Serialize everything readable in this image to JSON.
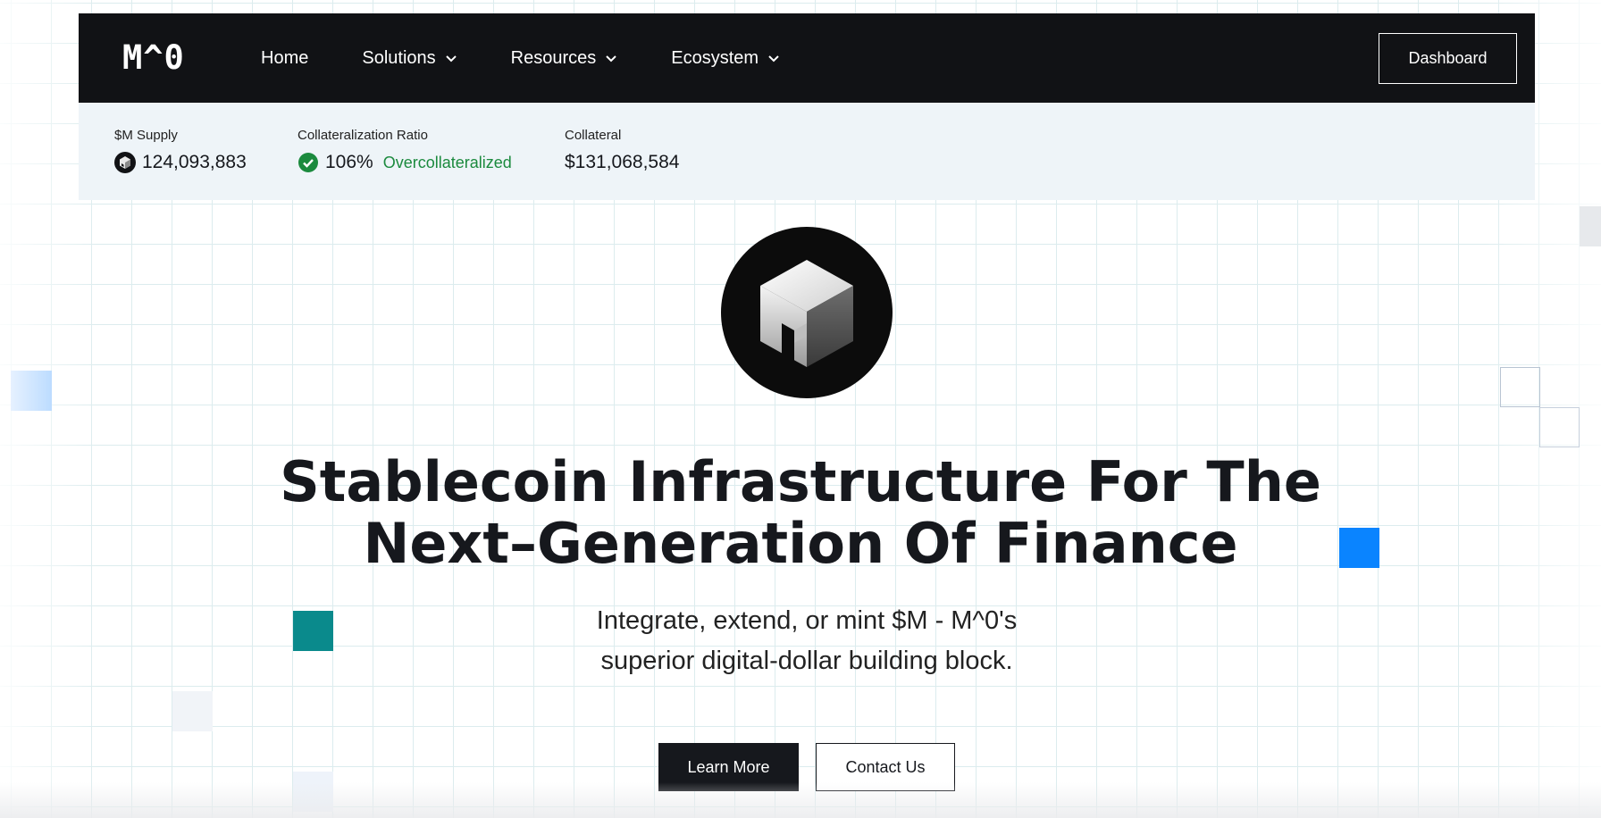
{
  "nav": {
    "logo": "M^0",
    "items": [
      {
        "label": "Home",
        "has_dropdown": false
      },
      {
        "label": "Solutions",
        "has_dropdown": true
      },
      {
        "label": "Resources",
        "has_dropdown": true
      },
      {
        "label": "Ecosystem",
        "has_dropdown": true
      }
    ],
    "dashboard_label": "Dashboard"
  },
  "stats": {
    "supply": {
      "label": "$M Supply",
      "value": "124,093,883",
      "icon": "m-token-icon"
    },
    "ratio": {
      "label": "Collateralization Ratio",
      "value": "106%",
      "status": "Overcollateralized",
      "icon": "check-circle-icon",
      "status_color": "#1b8a3e"
    },
    "collateral": {
      "label": "Collateral",
      "value": "$131,068,584"
    }
  },
  "hero": {
    "logo_icon": "m0-cube-icon",
    "headline_line1": "Stablecoin Infrastructure For The",
    "headline_line2": "Next–Generation Of Finance",
    "subtitle_line1": "Integrate, extend, or mint $M - M^0's",
    "subtitle_line2": "superior digital-dollar building block.",
    "primary_button": "Learn More",
    "secondary_button": "Contact Us"
  },
  "colors": {
    "navbar": "#111215",
    "stats_bg": "#eef4f8",
    "accent_blue": "#0a84ff",
    "accent_teal": "#0a8a8c",
    "success": "#1b8a3e"
  }
}
